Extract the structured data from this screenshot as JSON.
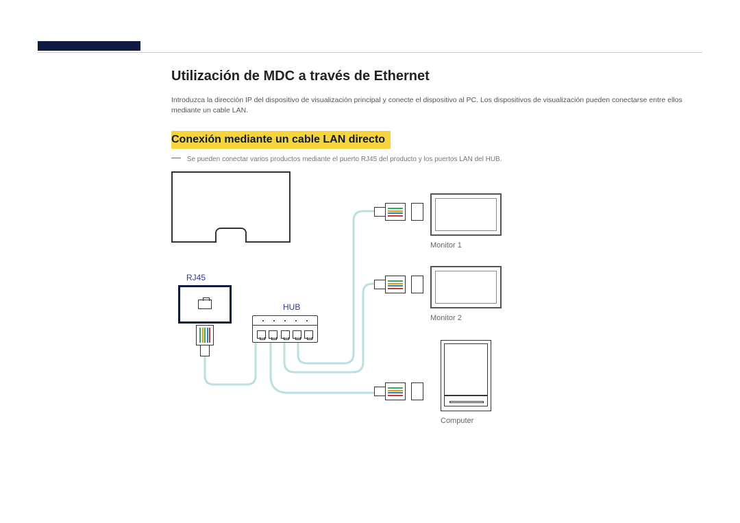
{
  "heading": "Utilización de MDC a través de Ethernet",
  "intro": "Introduzca la dirección IP del dispositivo de visualización principal y conecte el dispositivo al PC. Los dispositivos de visualización pueden conectarse entre ellos mediante un cable LAN.",
  "subheading": "Conexión mediante un cable LAN directo",
  "note": "Se pueden conectar varios productos mediante el puerto RJ45 del producto y los puertos LAN del HUB.",
  "labels": {
    "rj45": "RJ45",
    "hub": "HUB",
    "monitor1": "Monitor 1",
    "monitor2": "Monitor 2",
    "computer": "Computer"
  }
}
